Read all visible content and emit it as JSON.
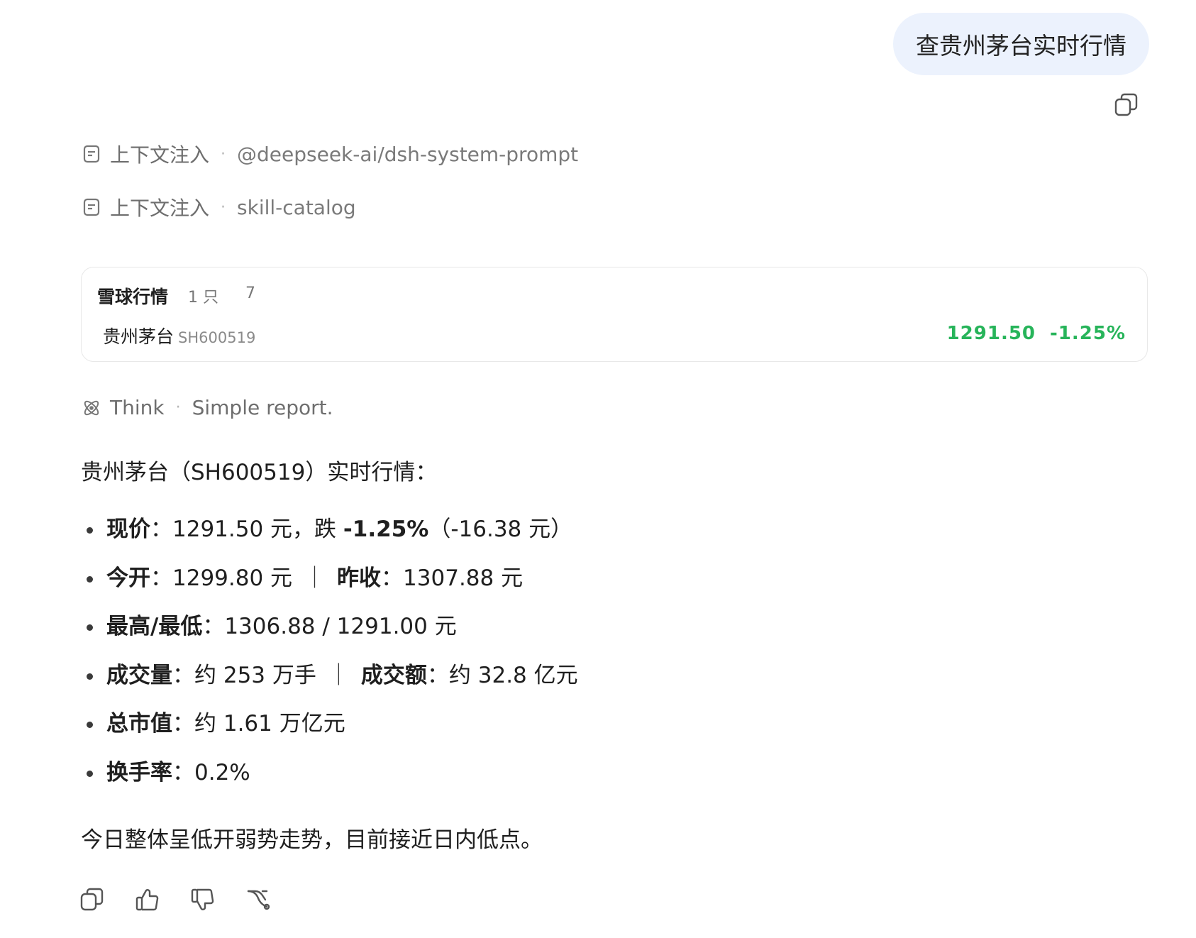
{
  "user_message": "查贵州茅台实时行情",
  "context_injections": [
    {
      "label": "上下文注入",
      "source": "@deepseek-ai/dsh-system-prompt"
    },
    {
      "label": "上下文注入",
      "source": "skill-catalog"
    }
  ],
  "quote_card": {
    "title": "雪球行情",
    "count": "1 只",
    "extra": "7",
    "stock_name": "贵州茅台",
    "stock_code": "SH600519",
    "price": "1291.50",
    "change_pct": "-1.25%",
    "price_color": "#27b45a"
  },
  "think": {
    "label": "Think",
    "summary": "Simple report."
  },
  "answer": {
    "intro": "贵州茅台（SH600519）实时行情：",
    "items": {
      "price": {
        "k": "现价",
        "colon": "：",
        "v1": "1291.50 元，跌 ",
        "bold": "-1.25%",
        "v2": "（-16.38 元）"
      },
      "open": {
        "k": "今开",
        "colon": "：",
        "v": "1299.80 元",
        "k2": "昨收",
        "v2": "1307.88 元"
      },
      "hilo": {
        "k": "最高/最低",
        "colon": "：",
        "v": "1306.88 / 1291.00 元"
      },
      "volume": {
        "k": "成交量",
        "colon": "：",
        "v": "约 253 万手",
        "k2": "成交额",
        "v2": "约 32.8 亿元"
      },
      "mcap": {
        "k": "总市值",
        "colon": "：",
        "v": "约 1.61 万亿元"
      },
      "turnover": {
        "k": "换手率",
        "colon": "：",
        "v": "0.2%"
      }
    },
    "separator": "｜",
    "summary": "今日整体呈低开弱势走势，目前接近日内低点。"
  },
  "icons": {
    "copy": "copy-icon",
    "document": "document-icon",
    "think": "atom-icon",
    "like": "thumbs-up-icon",
    "dislike": "thumbs-down-icon",
    "branch": "branch-icon"
  }
}
